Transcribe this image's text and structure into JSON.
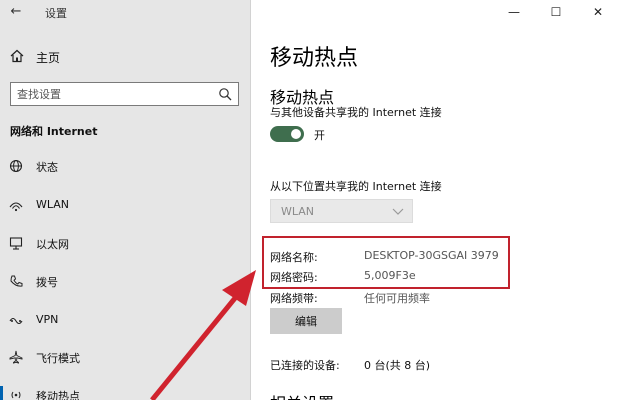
{
  "window": {
    "title": "设置",
    "controls": {
      "minimize": "—",
      "maximize": "☐",
      "close": "✕"
    }
  },
  "sidebar": {
    "home_label": "主页",
    "search_placeholder": "查找设置",
    "section_title": "网络和 Internet",
    "items": [
      {
        "label": "状态",
        "icon": "globe-icon"
      },
      {
        "label": "WLAN",
        "icon": "wifi-icon"
      },
      {
        "label": "以太网",
        "icon": "ethernet-icon"
      },
      {
        "label": "拨号",
        "icon": "dialup-icon"
      },
      {
        "label": "VPN",
        "icon": "vpn-icon"
      },
      {
        "label": "飞行模式",
        "icon": "airplane-icon"
      },
      {
        "label": "移动热点",
        "icon": "hotspot-icon",
        "active": true
      }
    ]
  },
  "main": {
    "page_title": "移动热点",
    "sub_title": "移动热点",
    "share_label": "与其他设备共享我的 Internet 连接",
    "toggle_label": "开",
    "toggle_on": true,
    "share_from_label": "从以下位置共享我的 Internet 连接",
    "share_from_value": "WLAN",
    "network_name_label": "网络名称:",
    "network_name_value": "DESKTOP-30GSGAI 3979",
    "network_password_label": "网络密码:",
    "network_password_value": "5,009F3e",
    "network_band_label": "网络频带:",
    "network_band_value": "任何可用频率",
    "edit_button": "编辑",
    "connected_label": "已连接的设备:",
    "connected_value": "0 台(共 8 台)",
    "cut_heading": "相关设置"
  },
  "colors": {
    "accent": "#0063b1",
    "toggle_on": "#3f6e4e",
    "annotation_red": "#c1222d"
  }
}
